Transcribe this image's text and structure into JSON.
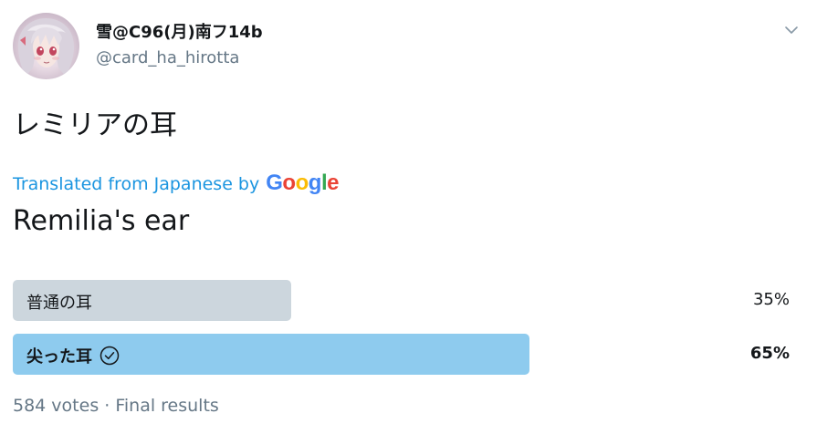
{
  "user": {
    "display_name": "雪@C96(月)南フ14b",
    "handle": "@card_ha_hirotta",
    "avatar": "anime-character-avatar"
  },
  "tweet": {
    "text": "レミリアの耳",
    "translation_prefix": "Translated from Japanese by",
    "translation_brand": "Google",
    "translated_text": "Remilia's ear"
  },
  "poll": {
    "options": [
      {
        "label": "普通の耳",
        "percent_text": "35%",
        "percent": 35,
        "winner": false
      },
      {
        "label": "尖った耳",
        "percent_text": "65%",
        "percent": 65,
        "winner": true
      }
    ],
    "footer": "584 votes · Final results"
  },
  "icons": {
    "menu": "chevron-down-icon",
    "winner": "check-circle-icon"
  },
  "colors": {
    "link": "#1b95e0",
    "secondary_text": "#657786",
    "loser_bar": "#ccd6dd",
    "winner_bar": "#8ecbee"
  }
}
